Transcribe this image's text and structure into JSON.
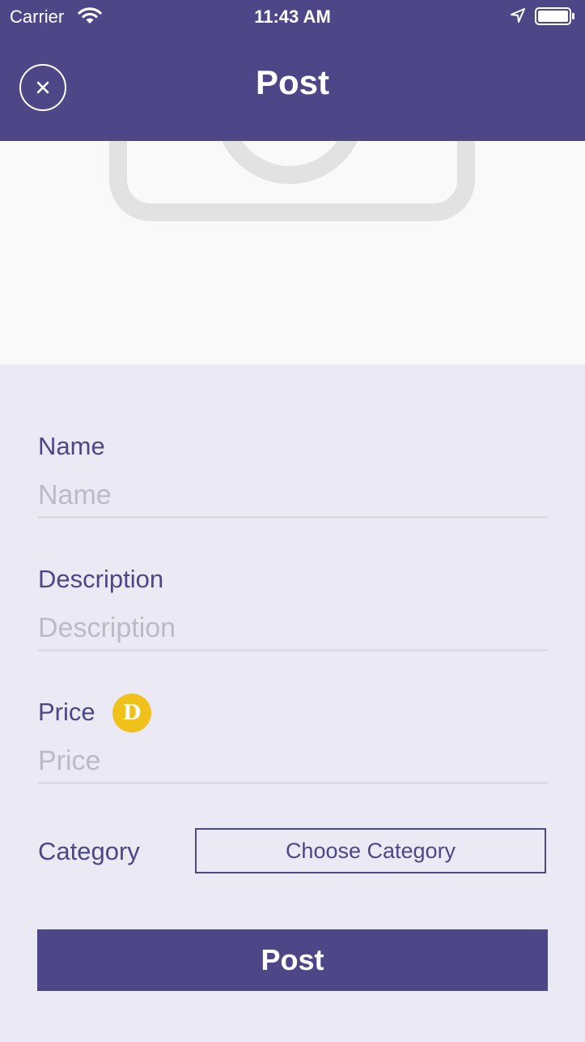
{
  "status_bar": {
    "carrier": "Carrier",
    "time": "11:43 AM",
    "icons": [
      "wifi-icon",
      "location-arrow-icon",
      "battery-icon"
    ]
  },
  "nav": {
    "title": "Post",
    "close_icon": "close-icon"
  },
  "photo": {
    "icon": "camera-icon"
  },
  "form": {
    "name": {
      "label": "Name",
      "placeholder": "Name",
      "value": ""
    },
    "description": {
      "label": "Description",
      "placeholder": "Description",
      "value": ""
    },
    "price": {
      "label": "Price",
      "placeholder": "Price",
      "value": "",
      "currency_icon": "coin-icon",
      "currency_symbol": "D"
    },
    "category": {
      "label": "Category",
      "button_label": "Choose Category"
    }
  },
  "post_button": {
    "label": "Post"
  },
  "colors": {
    "primary": "#4e4787",
    "background": "#ebe9f3",
    "photo_background": "#f9f9f9",
    "coin": "#f0c01b",
    "placeholder": "#bcbbc4"
  }
}
